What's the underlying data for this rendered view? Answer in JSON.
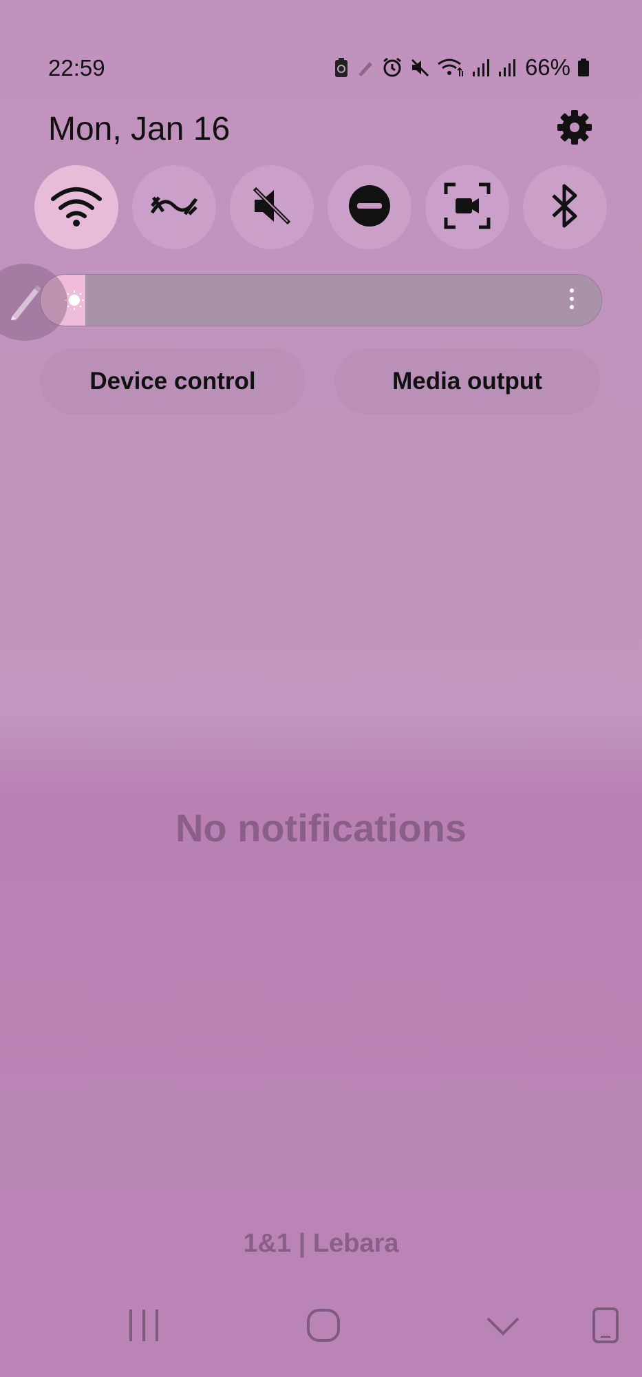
{
  "status_bar": {
    "time": "22:59",
    "battery_percent": "66%",
    "icons": [
      "battery-saver-icon",
      "pen-icon",
      "alarm-icon",
      "mute-icon",
      "wifi-icon",
      "signal-icon",
      "signal-icon",
      "battery-icon"
    ]
  },
  "header": {
    "date": "Mon, Jan 16",
    "settings_icon": "gear-icon"
  },
  "quick_tiles": [
    {
      "icon": "wifi-icon",
      "active": true
    },
    {
      "icon": "mobile-data-icon",
      "active": false
    },
    {
      "icon": "mute-icon",
      "active": false
    },
    {
      "icon": "do-not-disturb-icon",
      "active": false
    },
    {
      "icon": "screen-recorder-icon",
      "active": false
    },
    {
      "icon": "bluetooth-icon",
      "active": false
    }
  ],
  "brightness": {
    "level": 0.08,
    "icon": "sun-icon",
    "menu_icon": "more-vertical-icon"
  },
  "actions": {
    "device_control": "Device control",
    "media_output": "Media output"
  },
  "notifications": {
    "empty_text": "No notifications"
  },
  "carrier": "1&1 | Lebara",
  "colors": {
    "active_tile": "#e8bcd8",
    "brightness_fill": "#eebbd8",
    "muted_text": "#8a5f87"
  }
}
